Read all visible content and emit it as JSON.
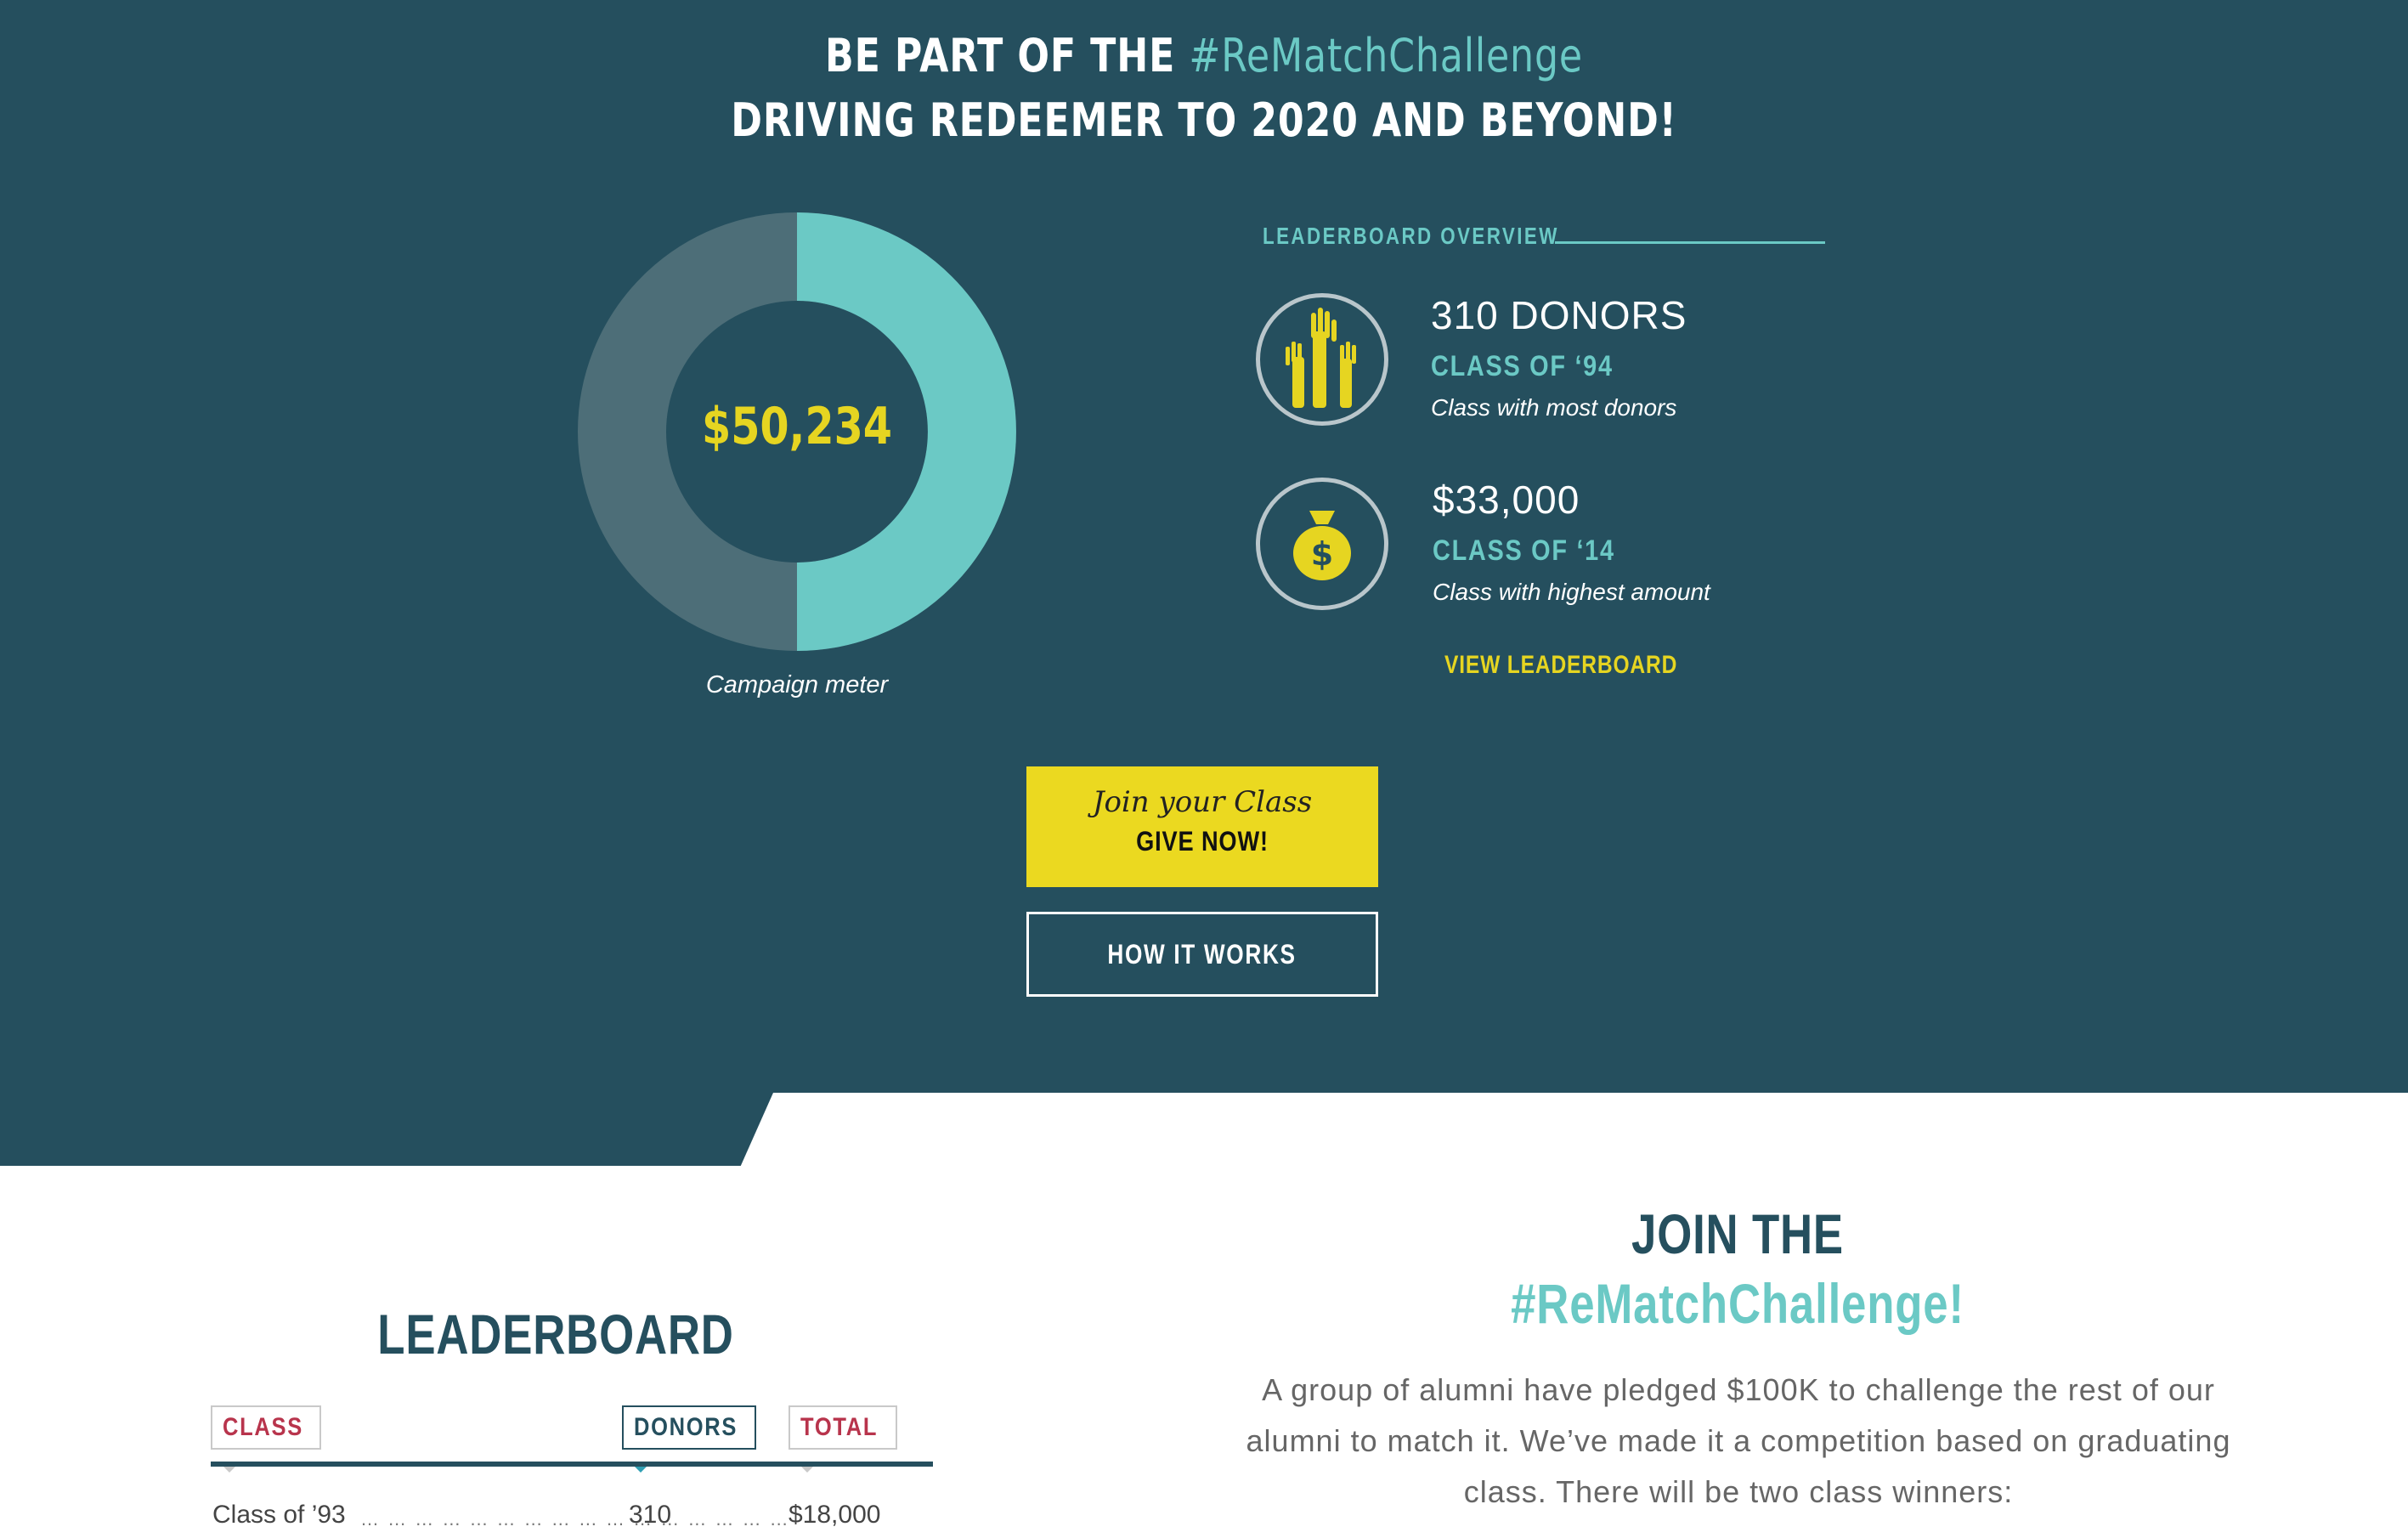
{
  "hero": {
    "headline_prefix": "BE PART OF THE ",
    "headline_hashtag": "#ReMatchChallenge",
    "headline_line2": "DRIVING REDEEMER TO 2020 AND BEYOND!"
  },
  "campaign_meter": {
    "amount": "$50,234",
    "caption": "Campaign meter",
    "progress_fraction": 0.5,
    "colors": {
      "filled": "#6bc9c5",
      "remaining": "#4d6e78"
    }
  },
  "leaderboard_overview": {
    "label": "LEADERBOARD OVERVIEW",
    "stats": [
      {
        "icon": "raised-hands-icon",
        "value": "310 DONORS",
        "class_name": "CLASS OF ‘94",
        "description": "Class with most donors"
      },
      {
        "icon": "money-bag-icon",
        "value": "$33,000",
        "class_name": "CLASS OF ‘14",
        "description": "Class with highest amount"
      }
    ],
    "view_link": "VIEW LEADERBOARD"
  },
  "buttons": {
    "give_script": "Join your Class",
    "give_main": "GIVE NOW!",
    "how_it_works": "HOW IT WORKS"
  },
  "leaderboard": {
    "title": "LEADERBOARD",
    "columns": [
      "CLASS",
      "DONORS",
      "TOTAL"
    ],
    "active_sort": "DONORS",
    "rows": [
      {
        "class_name": "Class of ’93",
        "donors": "310",
        "total": "$18,000"
      }
    ]
  },
  "join": {
    "title_line1": "JOIN THE",
    "title_line2": "#ReMatchChallenge!",
    "body": "A group of alumni have pledged $100K to challenge the rest of our alumni to match it. We’ve made it a competition based on graduating class. There will be two class winners:"
  },
  "colors": {
    "hero_bg": "#254f5e",
    "accent_teal": "#6bc9c5",
    "accent_yellow": "#ebd920",
    "accent_red": "#b8344c"
  }
}
